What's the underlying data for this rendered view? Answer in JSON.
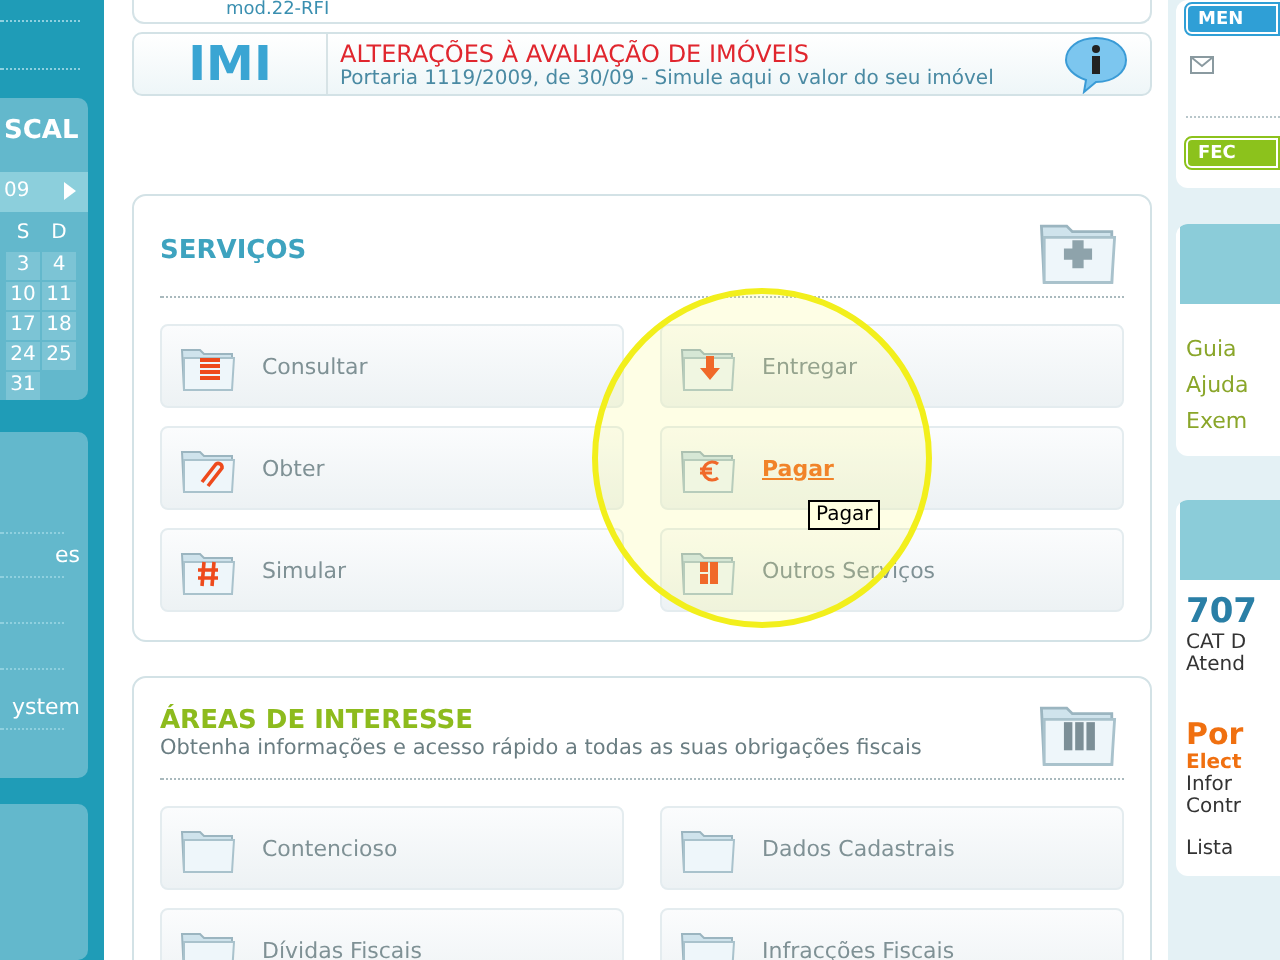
{
  "left_sidebar": {
    "title": "SCAL",
    "calendar": {
      "month": "09",
      "weekdays": [
        "S",
        "D"
      ],
      "weeks": [
        [
          "3",
          "4"
        ],
        [
          "10",
          "11"
        ],
        [
          "17",
          "18"
        ],
        [
          "24",
          "25"
        ],
        [
          "31"
        ]
      ]
    },
    "links": [
      "es",
      "ystem"
    ]
  },
  "top_card": {
    "text": "mod.22-RFI"
  },
  "banner": {
    "logo": "IMI",
    "title": "ALTERAÇÕES À AVALIAÇÃO DE IMÓVEIS",
    "subtitle": "Portaria 1119/2009, de 30/09 - Simule aqui o valor do seu imóvel"
  },
  "services": {
    "title": "SERVIÇOS",
    "items": [
      {
        "label": "Consultar",
        "kind": "calendar",
        "hovered": false
      },
      {
        "label": "Entregar",
        "kind": "download",
        "hovered": false
      },
      {
        "label": "Obter",
        "kind": "clip",
        "hovered": false
      },
      {
        "label": "Pagar",
        "kind": "euro",
        "hovered": true
      },
      {
        "label": "Simular",
        "kind": "hash",
        "hovered": false
      },
      {
        "label": "Outros Serviços",
        "kind": "grid",
        "hovered": false
      }
    ]
  },
  "areas": {
    "title": "ÁREAS DE INTERESSE",
    "subtitle": "Obtenha informações e acesso rápido a todas as suas obrigações fiscais",
    "items": [
      {
        "label": "Contencioso",
        "hovered": false
      },
      {
        "label": "Dados Cadastrais",
        "hovered": false
      },
      {
        "label": "Dívidas Fiscais",
        "hovered": false
      },
      {
        "label": "Infracções Fiscais",
        "hovered": false
      }
    ]
  },
  "tooltip": "Pagar",
  "right_sidebar": {
    "buttons": [
      {
        "label": "MEN",
        "kind": "menu"
      },
      {
        "label": "FEC",
        "kind": "close"
      }
    ],
    "links": [
      "Guia",
      "Ajuda",
      "Exem"
    ],
    "phone": "707",
    "phone_lines": [
      "CAT D",
      "Atend"
    ],
    "promo_title": "Por",
    "promo_subtitle": "Elect",
    "promo_lines": [
      "Infor",
      "Contr"
    ],
    "list_link": "Lista"
  }
}
